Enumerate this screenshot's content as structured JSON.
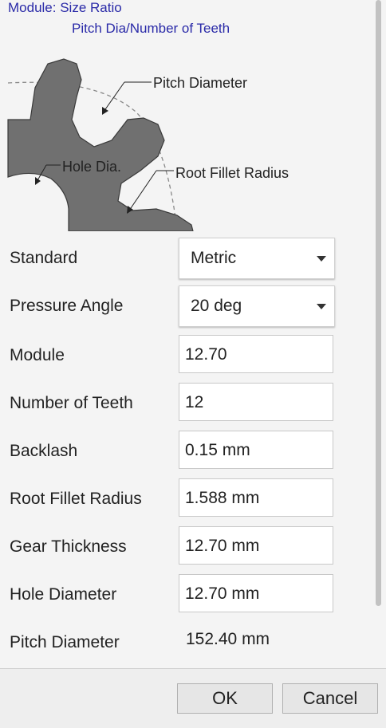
{
  "diagram": {
    "header_line1": "Module: Size Ratio",
    "header_line2": "Pitch Dia/Number of Teeth",
    "callout_pitch_diameter": "Pitch Diameter",
    "callout_hole_dia": "Hole Dia.",
    "callout_root_fillet": "Root Fillet Radius"
  },
  "form": {
    "standard": {
      "label": "Standard",
      "value": "Metric"
    },
    "pressure_angle": {
      "label": "Pressure Angle",
      "value": "20 deg"
    },
    "module": {
      "label": "Module",
      "value": "12.70"
    },
    "number_of_teeth": {
      "label": "Number of Teeth",
      "value": "12"
    },
    "backlash": {
      "label": "Backlash",
      "value": "0.15 mm"
    },
    "root_fillet_radius": {
      "label": "Root Fillet Radius",
      "value": "1.588 mm"
    },
    "gear_thickness": {
      "label": "Gear Thickness",
      "value": "12.70 mm"
    },
    "hole_diameter": {
      "label": "Hole Diameter",
      "value": "12.70 mm"
    },
    "pitch_diameter": {
      "label": "Pitch Diameter",
      "value": "152.40 mm"
    }
  },
  "buttons": {
    "ok": "OK",
    "cancel": "Cancel"
  },
  "colors": {
    "diagram_text": "#2a2aa8",
    "gear_fill": "#707070",
    "background": "#f4f4f4"
  }
}
